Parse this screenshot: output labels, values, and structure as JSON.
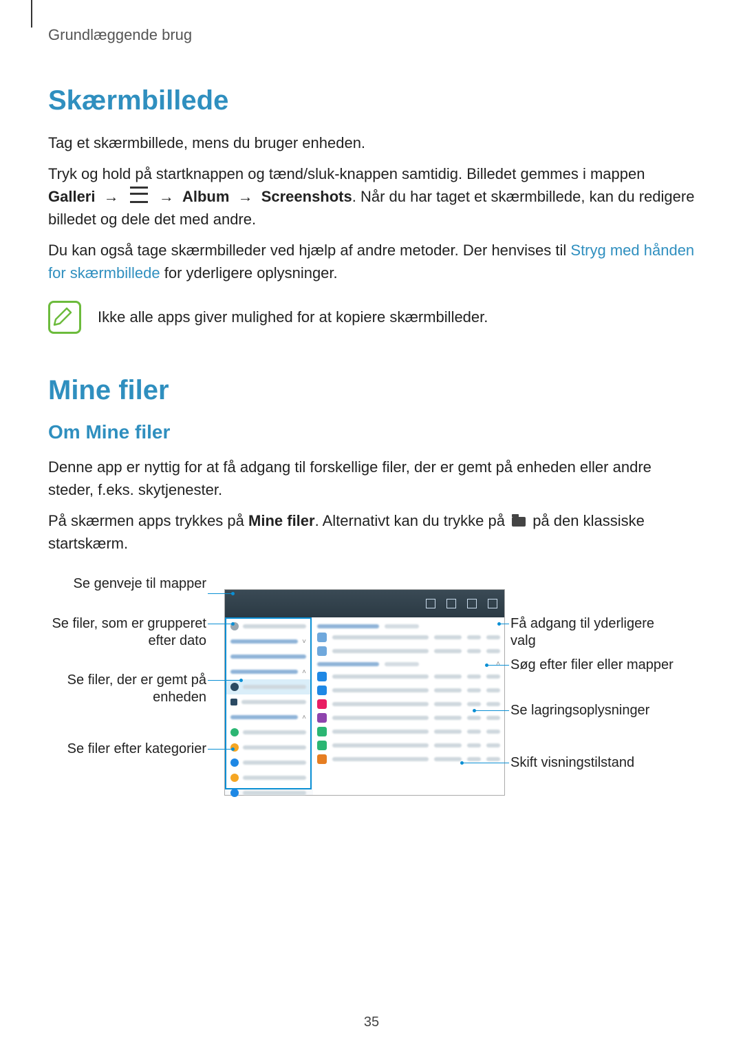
{
  "header": "Grundlæggende brug",
  "section1": {
    "title": "Skærmbillede",
    "p1": "Tag et skærmbillede, mens du bruger enheden.",
    "p2a": "Tryk og hold på startknappen og tænd/sluk-knappen samtidig. Billedet gemmes i mappen ",
    "p2_galleri": "Galleri",
    "p2_arrow": "→",
    "p2_album": "Album",
    "p2_screenshots": "Screenshots",
    "p2b": ". Når du har taget et skærmbillede, kan du redigere billedet og dele det med andre.",
    "p3a": "Du kan også tage skærmbilleder ved hjælp af andre metoder. Der henvises til ",
    "p3_link": "Stryg med hånden for skærmbillede",
    "p3b": " for yderligere oplysninger.",
    "note": "Ikke alle apps giver mulighed for at kopiere skærmbilleder."
  },
  "section2": {
    "title": "Mine filer",
    "sub": "Om Mine filer",
    "p1": "Denne app er nyttig for at få adgang til forskellige filer, der er gemt på enheden eller andre steder, f.eks. skytjenester.",
    "p2a": "På skærmen apps trykkes på ",
    "p2_bold": "Mine filer",
    "p2b": ". Alternativt kan du trykke på ",
    "p2c": " på den klassiske startskærm."
  },
  "callouts": {
    "l1": "Se genveje til mapper",
    "l2": "Se filer, som er grupperet efter dato",
    "l3": "Se filer, der er gemt på enheden",
    "l4": "Se filer efter kategorier",
    "r1": "Få adgang til yderligere valg",
    "r2": "Søg efter filer eller mapper",
    "r3": "Se lagringsoplysninger",
    "r4": "Skift visningstilstand"
  },
  "pageNumber": "35"
}
